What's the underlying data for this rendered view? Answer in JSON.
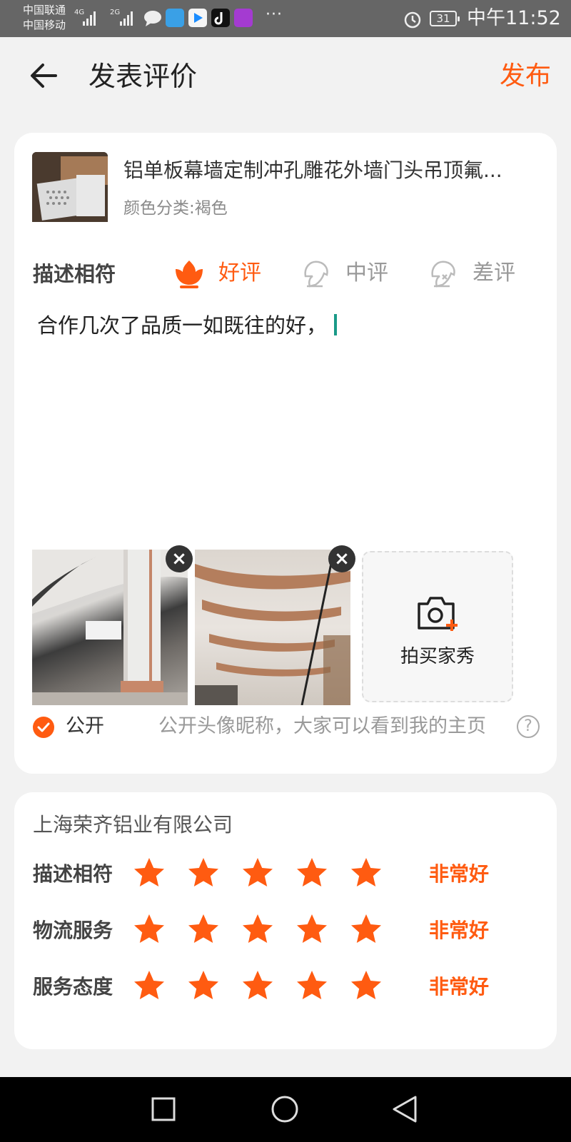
{
  "status_bar": {
    "carrier1": "中国联通",
    "carrier2": "中国移动",
    "net1": "4G",
    "net2": "2G",
    "more": "···",
    "battery": "31",
    "time": "中午11:52"
  },
  "header": {
    "title": "发表评价",
    "publish_label": "发布"
  },
  "product": {
    "name": "铝单板幕墙定制冲孔雕花外墙门头吊顶氟...",
    "sku": "颜色分类:褐色"
  },
  "rating": {
    "label": "描述相符",
    "options": [
      {
        "label": "好评"
      },
      {
        "label": "中评"
      },
      {
        "label": "差评"
      }
    ]
  },
  "review": {
    "text": "合作几次了品质一如既往的好，"
  },
  "photos": {
    "add_label": "拍买家秀"
  },
  "public": {
    "label": "公开",
    "description": "公开头像昵称，大家可以看到我的主页",
    "help": "?"
  },
  "shop": {
    "name": "上海荣齐铝业有限公司",
    "scores": [
      {
        "label": "描述相符",
        "stars": 5,
        "value": "非常好"
      },
      {
        "label": "物流服务",
        "stars": 5,
        "value": "非常好"
      },
      {
        "label": "服务态度",
        "stars": 5,
        "value": "非常好"
      }
    ]
  },
  "colors": {
    "accent": "#ff5b11",
    "status_bar": "#666666",
    "background": "#f2f2f2"
  }
}
